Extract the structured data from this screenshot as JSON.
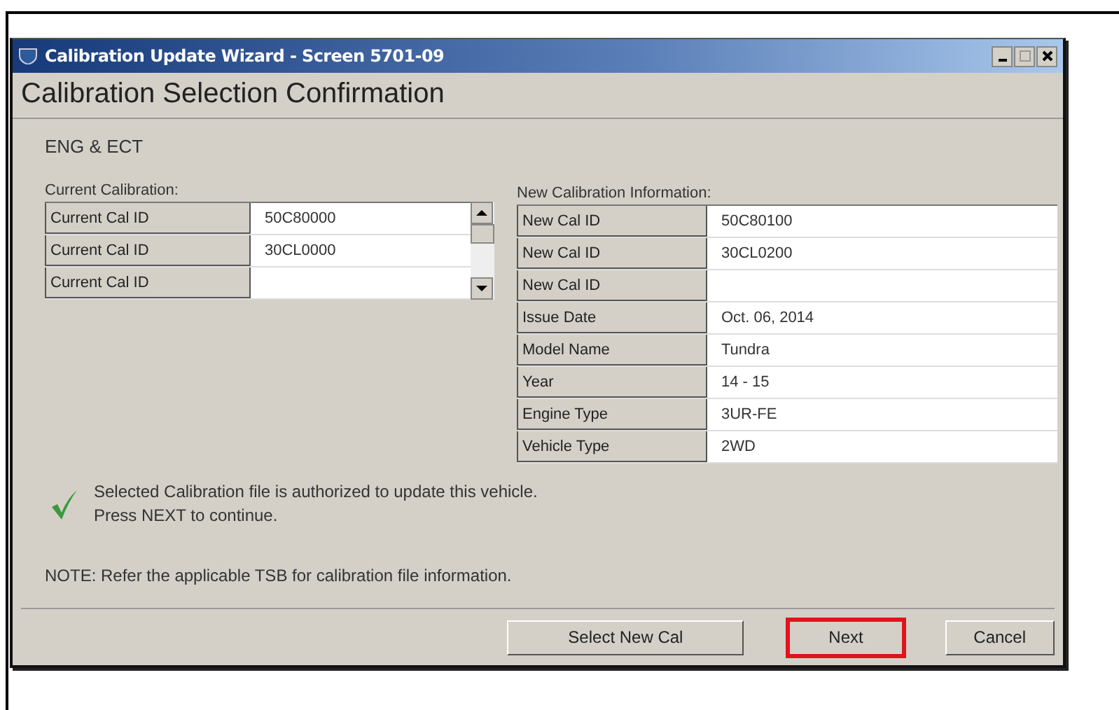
{
  "window": {
    "title": "Calibration Update Wizard - Screen 5701-09"
  },
  "header": "Calibration Selection Confirmation",
  "system": "ENG & ECT",
  "current": {
    "label": "Current Calibration:",
    "rows": [
      {
        "name": "Current Cal ID",
        "value": "50C80000"
      },
      {
        "name": "Current Cal ID",
        "value": "30CL0000"
      },
      {
        "name": "Current Cal ID"
      }
    ]
  },
  "new": {
    "label": "New Calibration Information:",
    "rows": [
      {
        "name": "New Cal ID",
        "value": "50C80100"
      },
      {
        "name": "New Cal ID",
        "value": "30CL0200"
      },
      {
        "name": "New Cal ID"
      },
      {
        "name": "Issue Date",
        "value": "Oct. 06, 2014"
      },
      {
        "name": "Model Name",
        "value": "Tundra"
      },
      {
        "name": "Year",
        "value": "14 - 15"
      },
      {
        "name": "Engine Type",
        "value": "3UR-FE"
      },
      {
        "name": "Vehicle Type",
        "value": "2WD"
      }
    ]
  },
  "message": {
    "lines": [
      "Selected Calibration file is authorized to update this vehicle.",
      "Press NEXT to continue."
    ]
  },
  "note": "NOTE: Refer the applicable TSB for calibration file information.",
  "buttons": [
    {
      "label": "Select New Cal",
      "highlighted": false
    },
    {
      "label": "Next",
      "highlighted": true
    },
    {
      "label": "Cancel",
      "highlighted": false
    }
  ]
}
